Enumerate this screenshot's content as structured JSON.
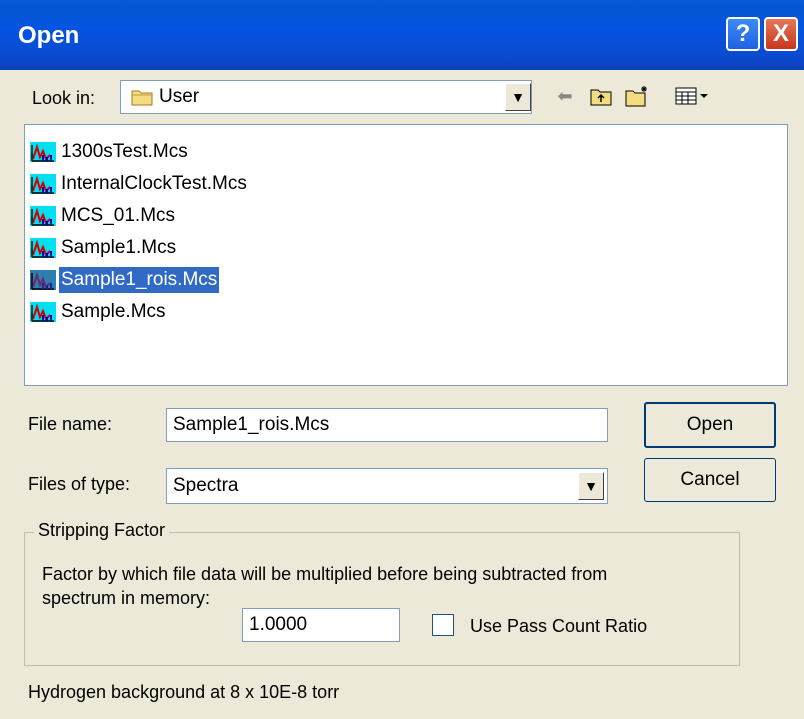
{
  "window": {
    "title": "Open"
  },
  "titlebar": {
    "help_glyph": "?",
    "close_glyph": "X"
  },
  "lookin": {
    "label": "Look in:",
    "value": "User"
  },
  "toolbar": {
    "icons": [
      "back-arrow-icon",
      "up-folder-icon",
      "new-folder-icon",
      "view-menu-icon"
    ]
  },
  "files": [
    {
      "name": "1300sTest.Mcs",
      "selected": false
    },
    {
      "name": "InternalClockTest.Mcs",
      "selected": false
    },
    {
      "name": "MCS_01.Mcs",
      "selected": false
    },
    {
      "name": "Sample1.Mcs",
      "selected": false
    },
    {
      "name": "Sample1_rois.Mcs",
      "selected": true
    },
    {
      "name": "Sample.Mcs",
      "selected": false
    }
  ],
  "filename": {
    "label": "File name:",
    "value": "Sample1_rois.Mcs"
  },
  "filetype": {
    "label": "Files of type:",
    "value": "Spectra"
  },
  "buttons": {
    "open": "Open",
    "cancel": "Cancel"
  },
  "stripping": {
    "legend": "Stripping Factor",
    "description_line1": "Factor by which file data will be multiplied before being subtracted from",
    "description_line2": "spectrum in memory:",
    "factor_value": "1.0000",
    "pass_count_label": "Use Pass Count Ratio",
    "pass_count_checked": false
  },
  "footer": {
    "note": "Hydrogen background at 8 x 10E-8 torr"
  },
  "colors": {
    "titlebar": "#0a54e0",
    "selection": "#316ac5",
    "dialog_bg": "#ece9d8"
  }
}
